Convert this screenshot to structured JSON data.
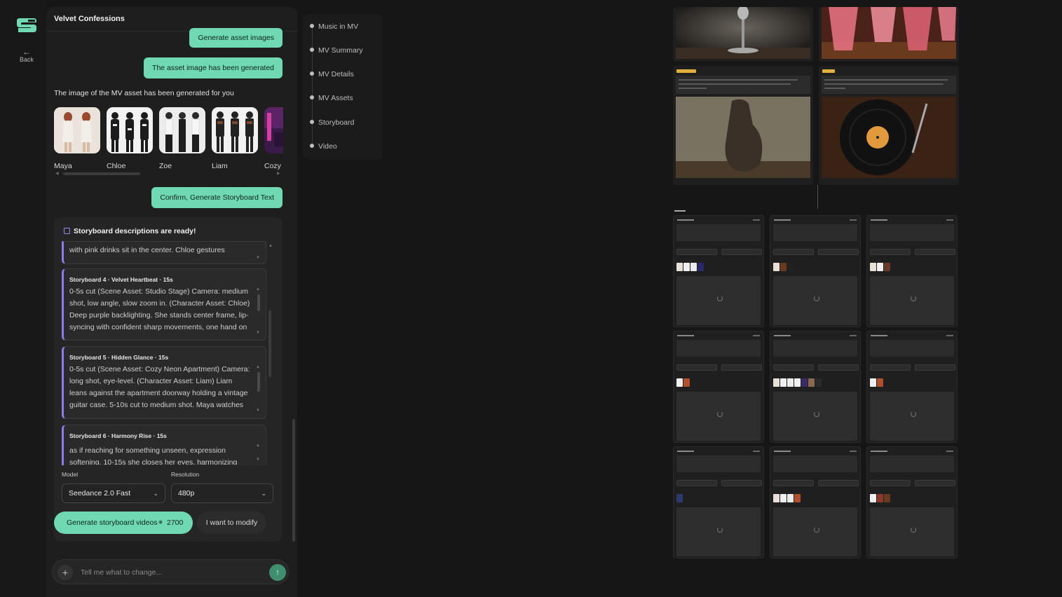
{
  "rail": {
    "back_label": "Back",
    "back_icon": "arrow-left-icon"
  },
  "chat": {
    "title": "Velvet Confessions",
    "messages": {
      "generate_assets": "Generate asset images",
      "asset_generated": "The asset image has been generated",
      "asset_info": "The image of the MV asset has been generated for you",
      "confirm": "Confirm, Generate Storyboard Text"
    },
    "assets": [
      {
        "name": "Maya"
      },
      {
        "name": "Chloe"
      },
      {
        "name": "Zoe"
      },
      {
        "name": "Liam"
      },
      {
        "name": "Cozy"
      }
    ],
    "storyboard_card": {
      "title": "Storyboard descriptions are ready!",
      "partial_text": "with pink drinks sit in the center. Chloe gestures",
      "items": [
        {
          "header": "Storyboard 4 · Velvet Heartbeat · 15s",
          "text": "0-5s cut (Scene Asset: Studio Stage) Camera: medium shot, low angle, slow zoom in. (Character Asset: Chloe) Deep purple backlighting. She stands center frame, lip-syncing with confident sharp movements, one hand on"
        },
        {
          "header": "Storyboard 5 · Hidden Glance · 15s",
          "text": "0-5s cut (Scene Asset: Cozy Neon Apartment) Camera: long shot, eye-level. (Character Asset: Liam) Liam leans against the apartment doorway holding a vintage guitar case. 5-10s cut to medium shot. Maya watches him"
        },
        {
          "header": "Storyboard 6 · Harmony Rise · 15s",
          "text": "as if reaching for something unseen, expression softening. 10-15s she closes her eyes, harmonizing"
        }
      ]
    },
    "model": {
      "label": "Model",
      "value": "Seedance 2.0 Fast"
    },
    "resolution": {
      "label": "Resolution",
      "value": "480p"
    },
    "generate_button": {
      "label": "Generate storyboard videos",
      "cost": "2700"
    },
    "modify_button": "I want to modify",
    "composer": {
      "placeholder": "Tell me what to change..."
    }
  },
  "steps": [
    "Music in MV",
    "MV Summary",
    "MV Details",
    "MV Assets",
    "Storyboard",
    "Video"
  ],
  "colors": {
    "accent": "#6ed9b2",
    "storyboard_border": "#8c7cf0",
    "tag": "#e3b23c"
  }
}
